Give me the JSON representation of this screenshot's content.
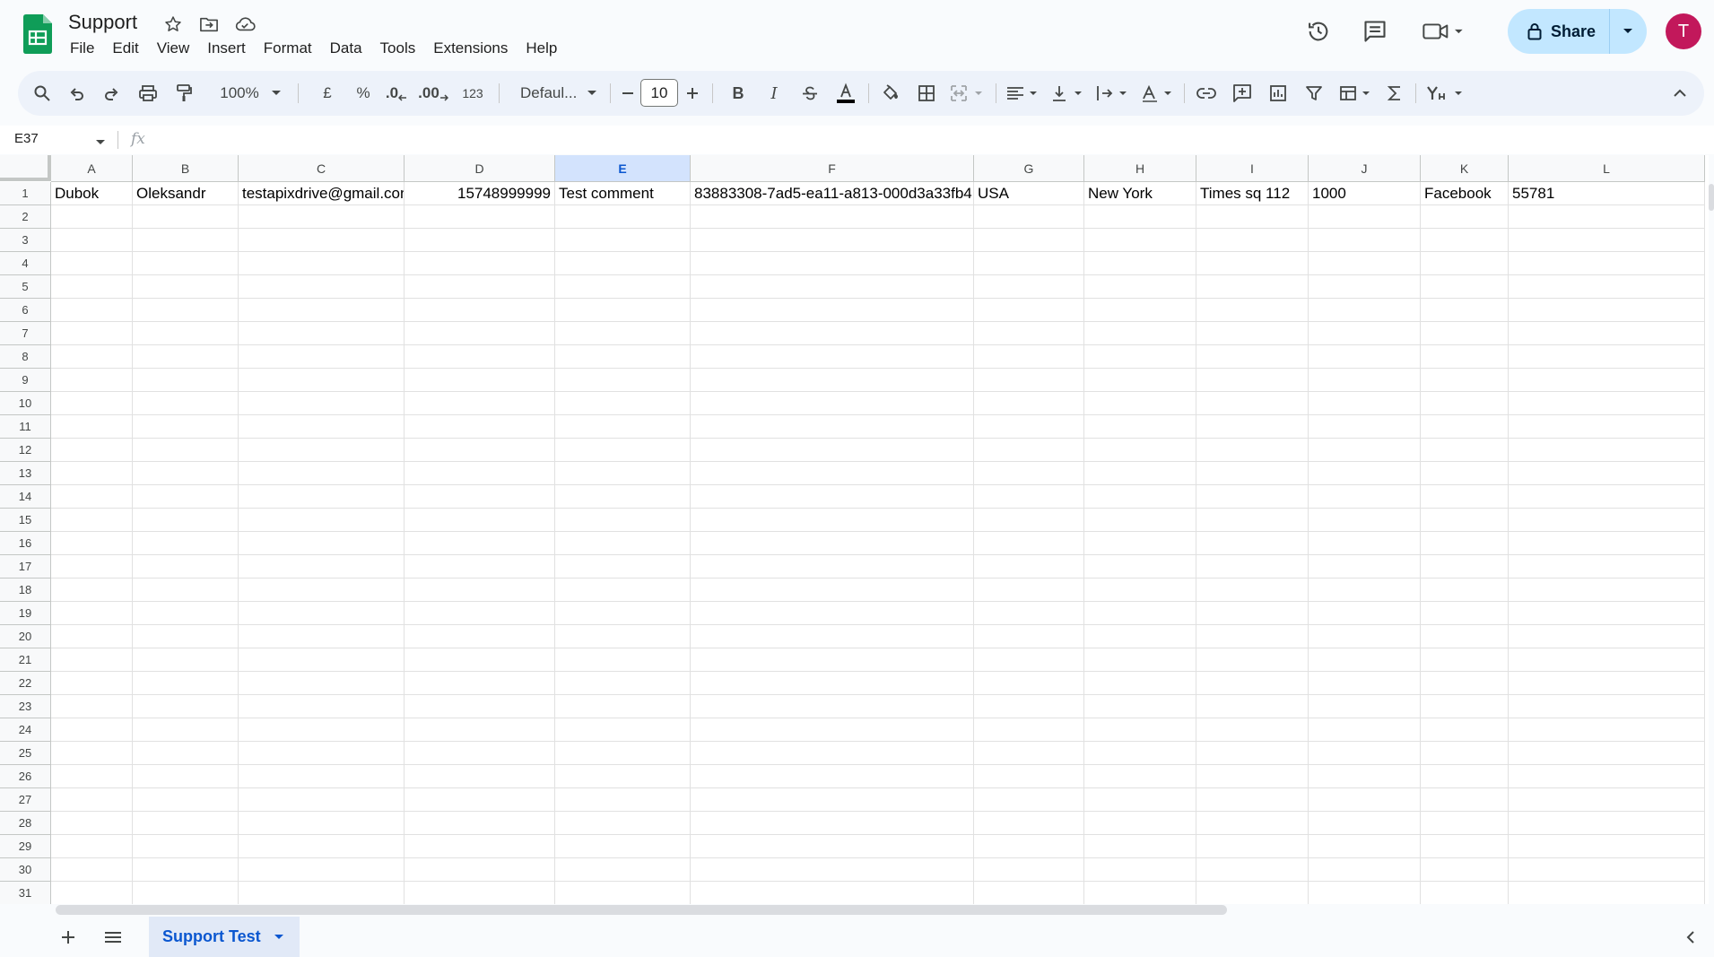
{
  "document": {
    "title": "Support"
  },
  "menu": [
    "File",
    "Edit",
    "View",
    "Insert",
    "Format",
    "Data",
    "Tools",
    "Extensions",
    "Help"
  ],
  "header": {
    "share_label": "Share",
    "avatar_initial": "T"
  },
  "toolbar": {
    "zoom": "100%",
    "currency": "£",
    "percent": "%",
    "decrease_decimal": ".0",
    "increase_decimal": ".00",
    "number_format": "123",
    "font": "Defaul...",
    "font_size": "10"
  },
  "formula_bar": {
    "cell_ref": "E37",
    "fx": "fx"
  },
  "grid": {
    "columns": [
      "A",
      "B",
      "C",
      "D",
      "E",
      "F",
      "G",
      "H",
      "I",
      "J",
      "K",
      "L"
    ],
    "selected_column": "E",
    "row_count": 31,
    "rows": [
      [
        "Dubok",
        "Oleksandr",
        "testapixdrive@gmail.con",
        "15748999999",
        "Test comment",
        "83883308-7ad5-ea11-a813-000d3a33fb4",
        "USA",
        "New York",
        "Times sq 112",
        "1000",
        "Facebook",
        "55781"
      ]
    ]
  },
  "sheets": {
    "active": "Support Test"
  },
  "colors": {
    "accent": "#0b57d0",
    "share_bg": "#c2e7ff",
    "avatar": "#c2185b",
    "logo": "#0f9d58"
  }
}
